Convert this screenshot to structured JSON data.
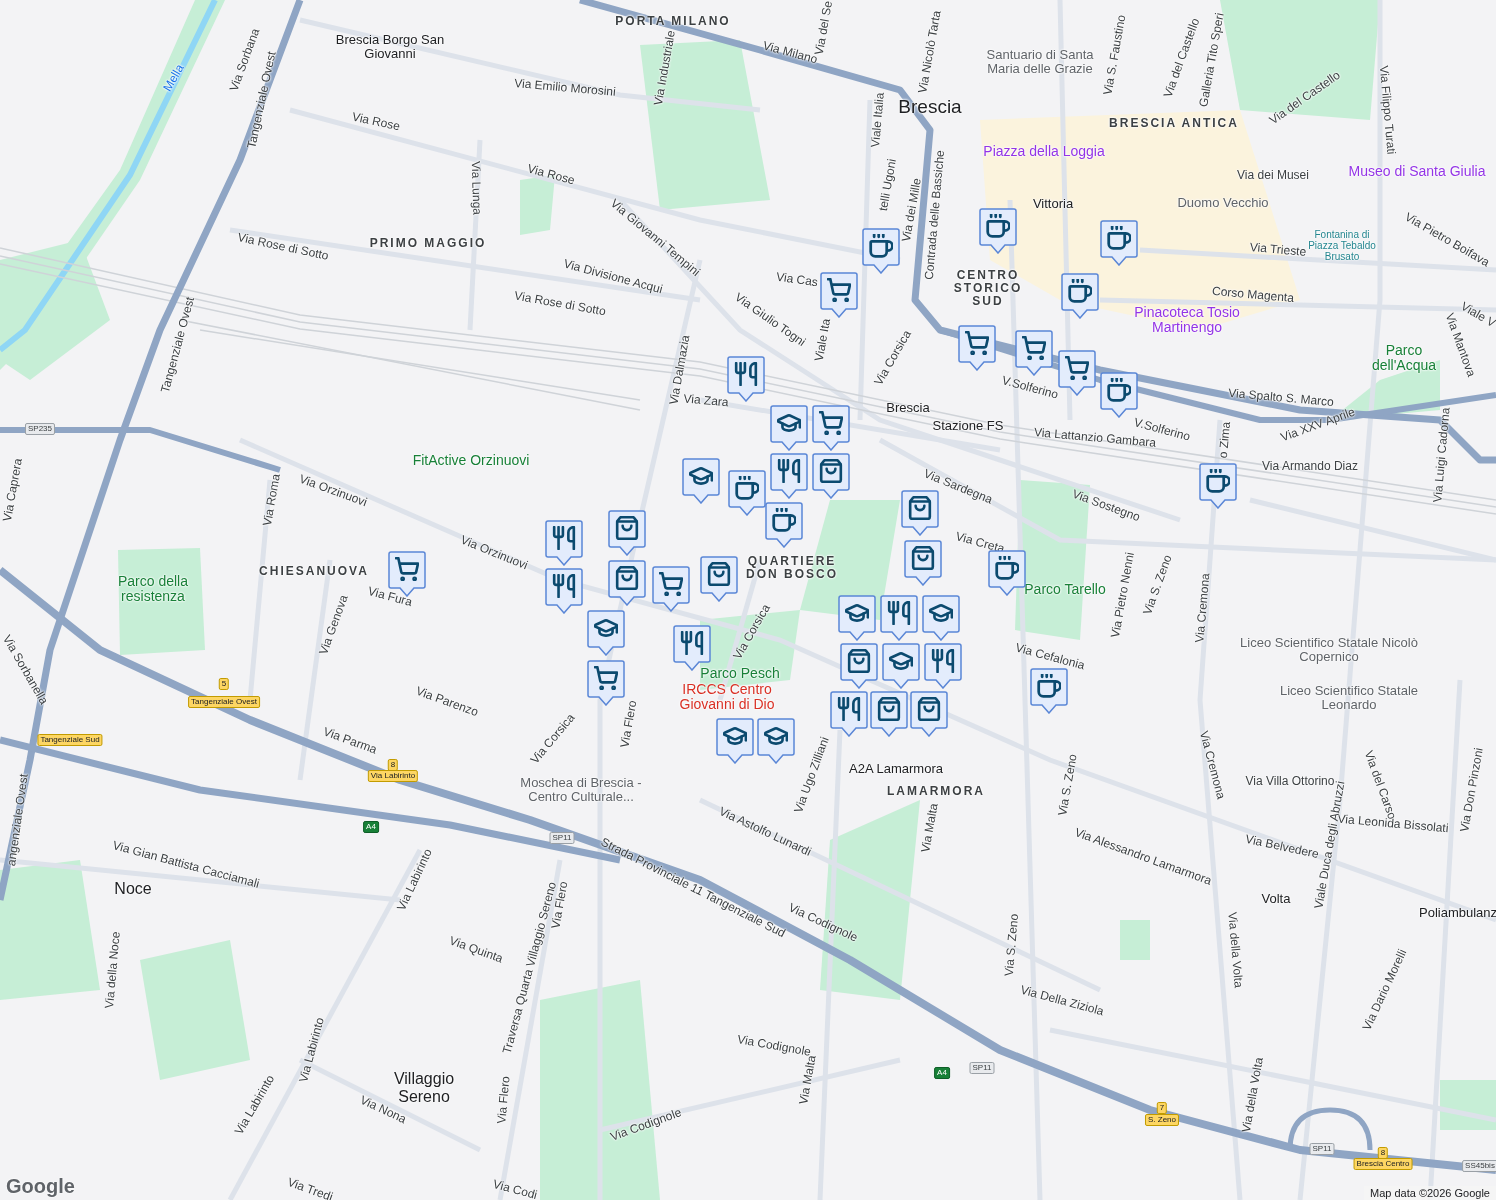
{
  "labels": [
    {
      "text": "PORTA MILANO",
      "kind": "district"
    },
    {
      "text": "Via del Se",
      "kind": "road"
    },
    {
      "text": "Via Nicolò Tarta",
      "kind": "road"
    },
    {
      "text": "Brescia Borgo San Giovanni",
      "kind": "place"
    },
    {
      "text": "Via Milano",
      "kind": "road"
    },
    {
      "text": "Via S. Faustino",
      "kind": "road"
    },
    {
      "text": "Via Sorbana",
      "kind": "road"
    },
    {
      "text": "Galleria Tito Speri",
      "kind": "road"
    },
    {
      "text": "Via del Castello",
      "kind": "road"
    },
    {
      "text": "Santuario di Santa Maria delle Grazie",
      "kind": "landmark"
    },
    {
      "text": "Via Industriale",
      "kind": "road"
    },
    {
      "text": "Mella",
      "kind": "water"
    },
    {
      "text": "Via Emilio Morosini",
      "kind": "road"
    },
    {
      "text": "Via del Castello",
      "kind": "road"
    },
    {
      "text": "Tangenziale Ovest",
      "kind": "road"
    },
    {
      "text": "Brescia",
      "kind": "city"
    },
    {
      "text": "Via Filippo Turati",
      "kind": "road"
    },
    {
      "text": "Viale Italia",
      "kind": "road"
    },
    {
      "text": "Via Rose",
      "kind": "road"
    },
    {
      "text": "BRESCIA ANTICA",
      "kind": "district"
    },
    {
      "text": "Piazza della Loggia",
      "kind": "museum"
    },
    {
      "text": "Via Rose",
      "kind": "road"
    },
    {
      "text": "Via dei Musei",
      "kind": "road"
    },
    {
      "text": "Museo di Santa Giulia",
      "kind": "museum"
    },
    {
      "text": "telli Ugoni",
      "kind": "road"
    },
    {
      "text": "Via Lunga",
      "kind": "road"
    },
    {
      "text": "Duomo Vecchio",
      "kind": "landmark"
    },
    {
      "text": "Vittoria",
      "kind": "place"
    },
    {
      "text": "Via dei Mille",
      "kind": "road"
    },
    {
      "text": "Contrada delle Bassiche",
      "kind": "road"
    },
    {
      "text": "Via Giovanni Tempini",
      "kind": "road"
    },
    {
      "text": "Via Pietro Boifava",
      "kind": "road"
    },
    {
      "text": "PRIMO MAGGIO",
      "kind": "district"
    },
    {
      "text": "Fontanina di Piazza Tebaldo Brusato",
      "kind": "fountain"
    },
    {
      "text": "Via Rose di Sotto",
      "kind": "road"
    },
    {
      "text": "Via Trieste",
      "kind": "road"
    },
    {
      "text": "Via Divisione Acqui",
      "kind": "road"
    },
    {
      "text": "Via Cas",
      "kind": "road"
    },
    {
      "text": "CENTRO STORICO SUD",
      "kind": "district"
    },
    {
      "text": "Corso Magenta",
      "kind": "road"
    },
    {
      "text": "Via Rose di Sotto",
      "kind": "road"
    },
    {
      "text": "Viale V",
      "kind": "road"
    },
    {
      "text": "Via Giulio Togni",
      "kind": "road"
    },
    {
      "text": "Pinacoteca Tosio Martinengo",
      "kind": "museum"
    },
    {
      "text": "Viale Ita",
      "kind": "road"
    },
    {
      "text": "Via Mantova",
      "kind": "road"
    },
    {
      "text": "Tangenziale Ovest",
      "kind": "road"
    },
    {
      "text": "Via Corsica",
      "kind": "road"
    },
    {
      "text": "Parco dell'Acqua",
      "kind": "park"
    },
    {
      "text": "Via Dalmazia",
      "kind": "road"
    },
    {
      "text": "V.Solferino",
      "kind": "road"
    },
    {
      "text": "Via Spalto S. Marco",
      "kind": "road"
    },
    {
      "text": "Via Zara",
      "kind": "road"
    },
    {
      "text": "Brescia",
      "kind": "place"
    },
    {
      "text": "Via XXV Aprile",
      "kind": "road"
    },
    {
      "text": "Stazione FS",
      "kind": "place"
    },
    {
      "text": "V.Solferino",
      "kind": "road"
    },
    {
      "text": "Via Lattanzio Gambara",
      "kind": "road"
    },
    {
      "text": "o Zima",
      "kind": "road"
    },
    {
      "text": "Via Luigi Cadorna",
      "kind": "road"
    },
    {
      "text": "FitActive Orzinuovi",
      "kind": "park"
    },
    {
      "text": "Via Armando Diaz",
      "kind": "road"
    },
    {
      "text": "Via Sardegna",
      "kind": "road"
    },
    {
      "text": "Via Caprera",
      "kind": "road"
    },
    {
      "text": "Via Orzinuovi",
      "kind": "road"
    },
    {
      "text": "Via Roma",
      "kind": "road"
    },
    {
      "text": "Via Sostegno",
      "kind": "road"
    },
    {
      "text": "Via Creta",
      "kind": "road"
    },
    {
      "text": "Via Orzinuovi",
      "kind": "road"
    },
    {
      "text": "CHIESANUOVA",
      "kind": "district"
    },
    {
      "text": "QUARTIERE DON BOSCO",
      "kind": "district"
    },
    {
      "text": "Via S. Zeno",
      "kind": "road"
    },
    {
      "text": "Parco della resistenza",
      "kind": "park"
    },
    {
      "text": "Parco Tarello",
      "kind": "park"
    },
    {
      "text": "Via Pietro Nenni",
      "kind": "road"
    },
    {
      "text": "Via Fura",
      "kind": "road"
    },
    {
      "text": "Via Cremona",
      "kind": "road"
    },
    {
      "text": "Via Genova",
      "kind": "road"
    },
    {
      "text": "Via Corsica",
      "kind": "road"
    },
    {
      "text": "Liceo Scientifico Statale Nicolò Copernico",
      "kind": "landmark"
    },
    {
      "text": "Via Cefalonia",
      "kind": "road"
    },
    {
      "text": "Via Sorbanella",
      "kind": "road"
    },
    {
      "text": "Parco Pesch",
      "kind": "park"
    },
    {
      "text": "IRCCS Centro Giovanni di Dio",
      "kind": "hospital"
    },
    {
      "text": "Liceo Scientifico Statale Leonardo",
      "kind": "landmark"
    },
    {
      "text": "Via Parenzo",
      "kind": "road"
    },
    {
      "text": "Via Flero",
      "kind": "road"
    },
    {
      "text": "Via Corsica",
      "kind": "road"
    },
    {
      "text": "Via Parma",
      "kind": "road"
    },
    {
      "text": "Via Cremona",
      "kind": "road"
    },
    {
      "text": "A2A Lamarmora",
      "kind": "place"
    },
    {
      "text": "Via Ugo Zilliani",
      "kind": "road"
    },
    {
      "text": "Via Villa Ottorino",
      "kind": "road"
    },
    {
      "text": "Via S. Zeno",
      "kind": "road"
    },
    {
      "text": "Via del Carso",
      "kind": "road"
    },
    {
      "text": "Moschea di Brescia - Centro Culturale...",
      "kind": "landmark"
    },
    {
      "text": "Via Don Pinzoni",
      "kind": "road"
    },
    {
      "text": "LAMARMORA",
      "kind": "district"
    },
    {
      "text": "angenziale Ovest",
      "kind": "road"
    },
    {
      "text": "Via Leonida Bissolati",
      "kind": "road"
    },
    {
      "text": "Via Malta",
      "kind": "road"
    },
    {
      "text": "Via Astolfo Lunardi",
      "kind": "road"
    },
    {
      "text": "Viale Duca degli Abruzzi",
      "kind": "road"
    },
    {
      "text": "Via Belvedere",
      "kind": "road"
    },
    {
      "text": "Via Alessandro Lamarmora",
      "kind": "road"
    },
    {
      "text": "Via Gian Battista Cacciamali",
      "kind": "road"
    },
    {
      "text": "Via Labirinto",
      "kind": "road"
    },
    {
      "text": "Strada Provinciale 11 Tangenziale Sud",
      "kind": "road"
    },
    {
      "text": "Noce",
      "kind": "town"
    },
    {
      "text": "Volta",
      "kind": "place"
    },
    {
      "text": "Via Flero",
      "kind": "road"
    },
    {
      "text": "Poliambulanz",
      "kind": "place"
    },
    {
      "text": "Via Codignole",
      "kind": "road"
    },
    {
      "text": "Via S. Zeno",
      "kind": "road"
    },
    {
      "text": "Via della Volta",
      "kind": "road"
    },
    {
      "text": "Via Quinta",
      "kind": "road"
    },
    {
      "text": "Traversa Quarta Villaggio Sereno",
      "kind": "road"
    },
    {
      "text": "Via della Noce",
      "kind": "road"
    },
    {
      "text": "Via Dario Morelli",
      "kind": "road"
    },
    {
      "text": "Via Della Ziziola",
      "kind": "road"
    },
    {
      "text": "Via Codignole",
      "kind": "road"
    },
    {
      "text": "Via Labirinto",
      "kind": "road"
    },
    {
      "text": "Via Malta",
      "kind": "road"
    },
    {
      "text": "Villaggio Sereno",
      "kind": "town"
    },
    {
      "text": "Via della Volta",
      "kind": "road"
    },
    {
      "text": "Via Flero",
      "kind": "road"
    },
    {
      "text": "Via Labirinto",
      "kind": "road"
    },
    {
      "text": "Via Nona",
      "kind": "road"
    },
    {
      "text": "Via Codignole",
      "kind": "road"
    },
    {
      "text": "Via Tredi",
      "kind": "road"
    },
    {
      "text": "Via Codi",
      "kind": "road"
    }
  ],
  "shields": [
    {
      "text": "SP235",
      "kind": "grey"
    },
    {
      "text": "5",
      "kind": "yellow"
    },
    {
      "text": "Tangenziale Ovest",
      "kind": "yellow"
    },
    {
      "text": "Tangenziale Sud",
      "kind": "yellow"
    },
    {
      "text": "8",
      "kind": "yellow"
    },
    {
      "text": "Via Labirinto",
      "kind": "yellow"
    },
    {
      "text": "A4",
      "kind": "green"
    },
    {
      "text": "SP11",
      "kind": "grey"
    },
    {
      "text": "SP11",
      "kind": "grey"
    },
    {
      "text": "A4",
      "kind": "green"
    },
    {
      "text": "7",
      "kind": "yellow"
    },
    {
      "text": "S. Zeno",
      "kind": "yellow"
    },
    {
      "text": "SP11",
      "kind": "grey"
    },
    {
      "text": "8",
      "kind": "yellow"
    },
    {
      "text": "Brescia Centro",
      "kind": "yellow"
    },
    {
      "text": "SS45bis",
      "kind": "grey"
    }
  ],
  "markers": [
    {
      "kind": "cafe"
    },
    {
      "kind": "cafe"
    },
    {
      "kind": "cafe"
    },
    {
      "kind": "cafe"
    },
    {
      "kind": "cafe"
    },
    {
      "kind": "cafe"
    },
    {
      "kind": "cafe"
    },
    {
      "kind": "cafe"
    },
    {
      "kind": "cafe"
    },
    {
      "kind": "cafe"
    },
    {
      "kind": "cart"
    },
    {
      "kind": "cart"
    },
    {
      "kind": "cart"
    },
    {
      "kind": "cart"
    },
    {
      "kind": "cart"
    },
    {
      "kind": "cart"
    },
    {
      "kind": "cart"
    },
    {
      "kind": "cart"
    },
    {
      "kind": "food"
    },
    {
      "kind": "food"
    },
    {
      "kind": "food"
    },
    {
      "kind": "food"
    },
    {
      "kind": "food"
    },
    {
      "kind": "food"
    },
    {
      "kind": "food"
    },
    {
      "kind": "food"
    },
    {
      "kind": "school"
    },
    {
      "kind": "school"
    },
    {
      "kind": "school"
    },
    {
      "kind": "school"
    },
    {
      "kind": "school"
    },
    {
      "kind": "school"
    },
    {
      "kind": "school"
    },
    {
      "kind": "school"
    },
    {
      "kind": "shop"
    },
    {
      "kind": "shop"
    },
    {
      "kind": "shop"
    },
    {
      "kind": "shop"
    },
    {
      "kind": "shop"
    },
    {
      "kind": "shop"
    },
    {
      "kind": "shop"
    },
    {
      "kind": "shop"
    },
    {
      "kind": "shop"
    }
  ],
  "logo": "Google",
  "attribution": "Map data ©2026 Google"
}
